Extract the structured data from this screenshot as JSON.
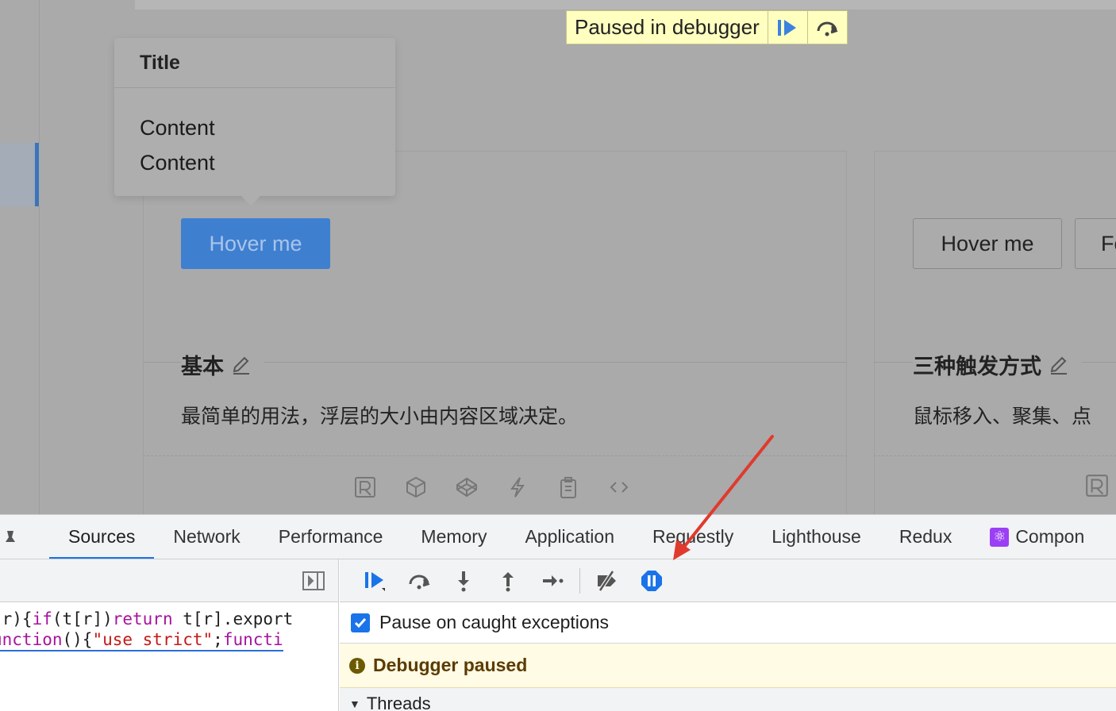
{
  "page": {
    "popover": {
      "title": "Title",
      "content": [
        "Content",
        "Content"
      ]
    },
    "debugger_overlay": {
      "label": "Paused in debugger",
      "resume_icon": "resume-icon",
      "step_over_icon": "step-over-icon"
    },
    "card1": {
      "button_label": "Hover me",
      "section_title": "基本",
      "section_desc": "最简单的用法，浮层的大小由内容区域决定。",
      "action_icons": [
        "riddle-icon",
        "codesandbox-icon",
        "codepen-icon",
        "stackblitz-icon",
        "copy-icon",
        "code-icon"
      ]
    },
    "card2": {
      "button1_label": "Hover me",
      "button2_label": "Fo",
      "section_title": "三种触发方式",
      "section_desc": "鼠标移入、聚集、点"
    }
  },
  "devtools": {
    "tabs": [
      "Sources",
      "Network",
      "Performance",
      "Memory",
      "Application",
      "Requestly",
      "Lighthouse",
      "Redux",
      "Compon"
    ],
    "active_tab": "Sources",
    "react_icon": "⚛",
    "code_lines": [
      {
        "p1": "(r){",
        "k1": "if",
        "p2": "(t[r])",
        "k2": "return",
        "p3": " t[r].export"
      },
      {
        "k1": "unction",
        "p1": "(){",
        "s1": "\"use strict\"",
        "p2": ";",
        "k2": "functi"
      }
    ],
    "pause_on_caught": {
      "label": "Pause on caught exceptions",
      "checked": true
    },
    "paused_label": "Debugger paused",
    "threads_label": "Threads"
  },
  "colors": {
    "accent": "#1a73e8",
    "paused_bg": "#fffbe5",
    "overlay_bg": "#ffffc0",
    "arrow": "#e03a2f"
  }
}
